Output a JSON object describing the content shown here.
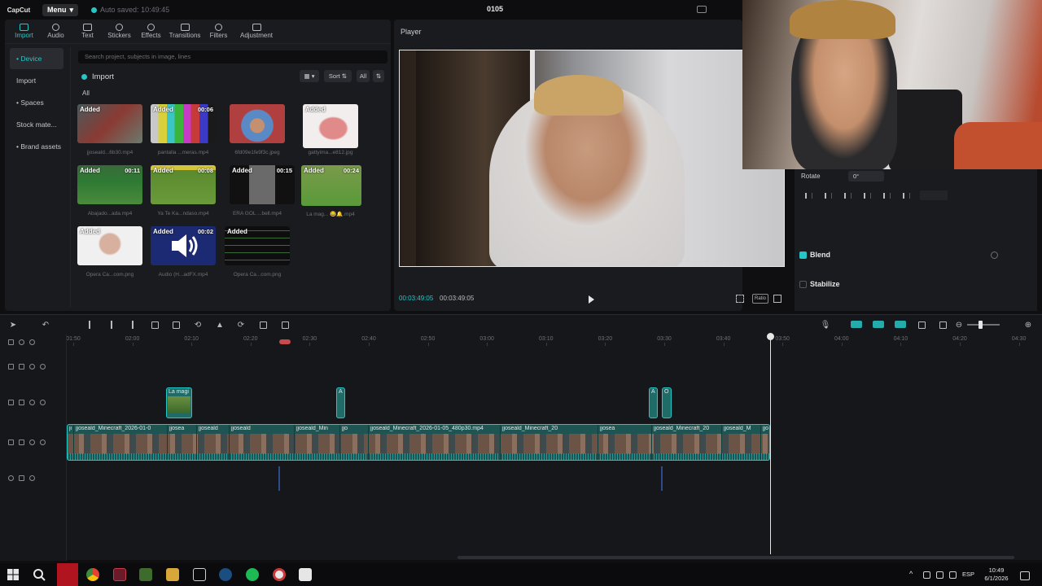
{
  "titlebar": {
    "app_logo": "CapCut",
    "menu_label": "Menu",
    "autosave_text": "Auto saved: 10:49:45",
    "project_name": "0105"
  },
  "media_panel": {
    "tabs": [
      {
        "label": "Import",
        "icon": "import-icon",
        "active": true
      },
      {
        "label": "Audio",
        "icon": "audio-icon"
      },
      {
        "label": "Text",
        "icon": "text-icon"
      },
      {
        "label": "Stickers",
        "icon": "sticker-icon"
      },
      {
        "label": "Effects",
        "icon": "effects-icon"
      },
      {
        "label": "Transitions",
        "icon": "transitions-icon"
      },
      {
        "label": "Filters",
        "icon": "filters-icon"
      },
      {
        "label": "Adjustment",
        "icon": "adjustment-icon"
      }
    ],
    "sidebar": [
      {
        "label": "• Device",
        "active": true
      },
      {
        "label": "Import"
      },
      {
        "label": "• Spaces"
      },
      {
        "label": "Stock mate..."
      },
      {
        "label": "• Brand assets"
      }
    ],
    "search_placeholder": "Search project, subjects in image, lines",
    "import_label": "Import",
    "sort_label": "Sort",
    "all_btn_label": "All",
    "all_label": "All",
    "added_label": "Added",
    "items": [
      {
        "name": "jjoseald...6b30.mp4",
        "duration": ""
      },
      {
        "name": "pantalla ...meras.mp4",
        "duration": "00:06"
      },
      {
        "name": "6fd09e1fe9f3c.jpeg",
        "duration": ""
      },
      {
        "name": "gattyima...e812.jpg",
        "duration": ""
      },
      {
        "name": "Abajado...ada.mp4",
        "duration": "00:11"
      },
      {
        "name": "Ya Te Ka...ndaso.mp4",
        "duration": "00:08"
      },
      {
        "name": "ERA GOL ...bell.mp4",
        "duration": "00:15"
      },
      {
        "name": "La mag... 😂🔔.mp4",
        "duration": "00:24"
      },
      {
        "name": "Opera Ca...com.png",
        "duration": ""
      },
      {
        "name": "Audio (H...adFX.mp4",
        "duration": "00:02"
      },
      {
        "name": "Opera Ca...com.png",
        "duration": ""
      }
    ]
  },
  "player": {
    "title": "Player",
    "current_time": "00:03:49:05",
    "total_time": "00:03:49:05",
    "ratio_label": "Ratio"
  },
  "properties": {
    "rotate_label": "Rotate",
    "rotate_value": "0°",
    "blend_label": "Blend",
    "stabilize_label": "Stabilize"
  },
  "timeline": {
    "ruler": [
      "01:50",
      "02:00",
      "02:10",
      "02:20",
      "02:30",
      "02:40",
      "02:50",
      "03:00",
      "03:10",
      "03:20",
      "03:30",
      "03:40",
      "03:50",
      "04:00",
      "04:10",
      "04:20",
      "04:30"
    ],
    "overlay_clips": [
      {
        "label": "La magi"
      },
      {
        "label": "A"
      },
      {
        "label": "A"
      },
      {
        "label": "O"
      }
    ],
    "main_clip_segments": [
      "jo",
      "jjoseald_Minecraft_2026-01-0",
      "jjosea",
      "jjoseald",
      "jjoseald",
      "jjoseald_Min",
      "jjo",
      "jjoseald_Minecraft_2026-01-05_480p30.mp4",
      "jjoseald_Minecraft_20",
      "jjosea",
      "jjoseald_Minecraft_20",
      "jjoseald_M",
      "jjo"
    ]
  },
  "taskbar": {
    "language": "ESP",
    "time": "10:49",
    "date": "6/1/2026"
  }
}
